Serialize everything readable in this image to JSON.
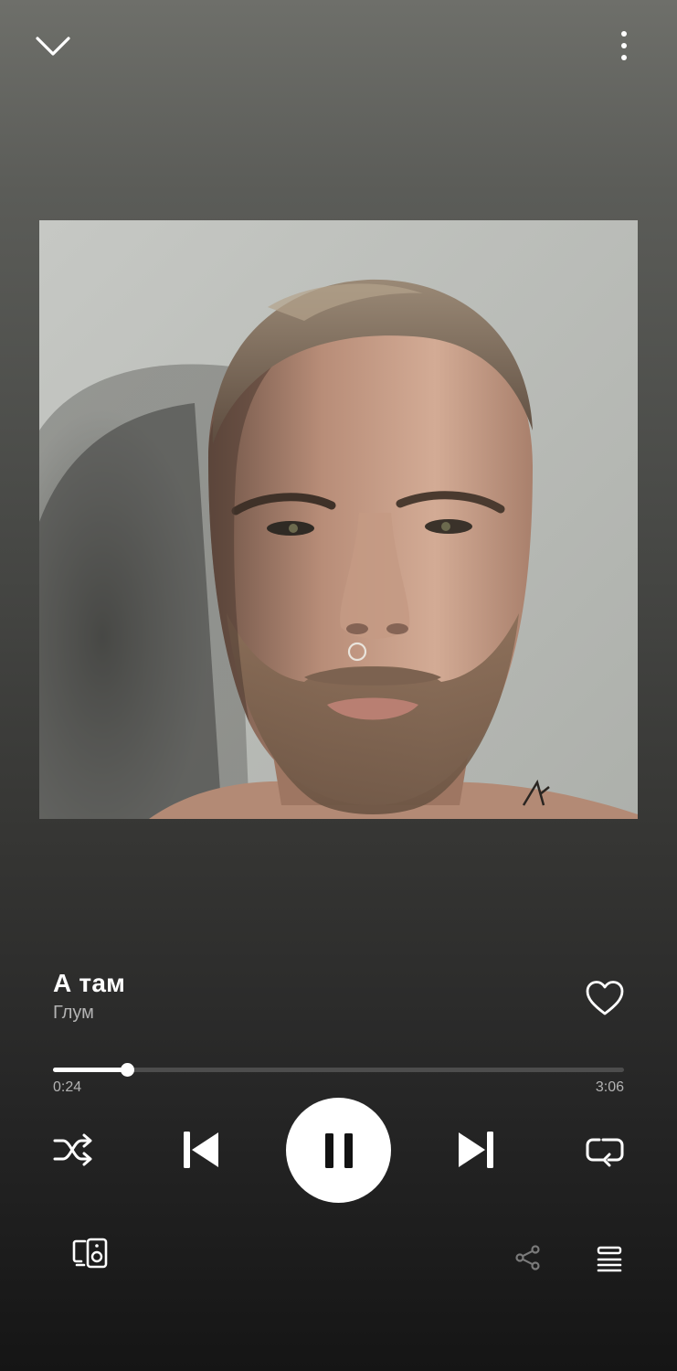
{
  "colors": {
    "accent": "#ffffff",
    "secondary_text": "#b3b3b3",
    "track_background": "#4d4d4d"
  },
  "header": {
    "collapse_icon": "chevron-down-icon",
    "more_icon": "more-vertical-icon"
  },
  "now_playing": {
    "title": "А там",
    "artist": "Глум",
    "liked": false
  },
  "progress": {
    "elapsed": "0:24",
    "total": "3:06",
    "fraction": 0.129
  },
  "controls": {
    "shuffle_icon": "shuffle-icon",
    "previous_icon": "skip-previous-icon",
    "play_state": "playing",
    "pause_icon": "pause-icon",
    "next_icon": "skip-next-icon",
    "repeat_icon": "repeat-icon"
  },
  "footer": {
    "devices_icon": "connect-device-icon",
    "share_icon": "share-icon",
    "queue_icon": "queue-icon"
  }
}
